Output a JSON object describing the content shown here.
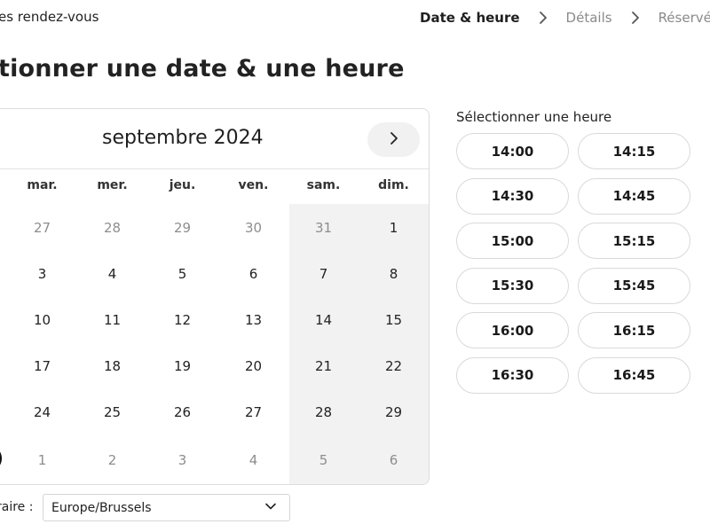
{
  "header": {
    "app_title": "es rendez-vous",
    "steps": [
      {
        "label": "Date & heure",
        "active": true
      },
      {
        "label": "Détails",
        "active": false
      },
      {
        "label": "Réservé",
        "active": false
      }
    ],
    "step_separator_icon": "chevron-right-icon"
  },
  "page_title": "tionner une date & une heure",
  "calendar": {
    "month": "septembre 2024",
    "next_icon": "chevron-right-icon",
    "weekdays": [
      "mar.",
      "mer.",
      "jeu.",
      "ven.",
      "sam.",
      "dim."
    ],
    "weeks": [
      [
        {
          "d": "27",
          "m": true
        },
        {
          "d": "28",
          "m": true
        },
        {
          "d": "29",
          "m": true
        },
        {
          "d": "30",
          "m": true
        },
        {
          "d": "31",
          "m": true
        },
        {
          "d": "1",
          "m": false
        }
      ],
      [
        {
          "d": "3",
          "m": false
        },
        {
          "d": "4",
          "m": false
        },
        {
          "d": "5",
          "m": false
        },
        {
          "d": "6",
          "m": false
        },
        {
          "d": "7",
          "m": false
        },
        {
          "d": "8",
          "m": false
        }
      ],
      [
        {
          "d": "10",
          "m": false
        },
        {
          "d": "11",
          "m": false
        },
        {
          "d": "12",
          "m": false
        },
        {
          "d": "13",
          "m": false
        },
        {
          "d": "14",
          "m": false
        },
        {
          "d": "15",
          "m": false
        }
      ],
      [
        {
          "d": "17",
          "m": false
        },
        {
          "d": "18",
          "m": false
        },
        {
          "d": "19",
          "m": false
        },
        {
          "d": "20",
          "m": false
        },
        {
          "d": "21",
          "m": false
        },
        {
          "d": "22",
          "m": false
        }
      ],
      [
        {
          "d": "24",
          "m": false
        },
        {
          "d": "25",
          "m": false
        },
        {
          "d": "26",
          "m": false
        },
        {
          "d": "27",
          "m": false
        },
        {
          "d": "28",
          "m": false
        },
        {
          "d": "29",
          "m": false
        }
      ],
      [
        {
          "d": "1",
          "m": true
        },
        {
          "d": "2",
          "m": true
        },
        {
          "d": "3",
          "m": true
        },
        {
          "d": "4",
          "m": true
        },
        {
          "d": "5",
          "m": true
        },
        {
          "d": "6",
          "m": true
        }
      ]
    ],
    "weekend_shade_color": "#f2f2f2",
    "muted_color": "#8d8d8d"
  },
  "timezone": {
    "label": "raire :",
    "value": "Europe/Brussels",
    "dropdown_icon": "chevron-down-icon"
  },
  "times": {
    "label": "Sélectionner une heure",
    "slots": [
      "14:00",
      "14:15",
      "14:30",
      "14:45",
      "15:00",
      "15:15",
      "15:30",
      "15:45",
      "16:00",
      "16:15",
      "16:30",
      "16:45"
    ]
  }
}
